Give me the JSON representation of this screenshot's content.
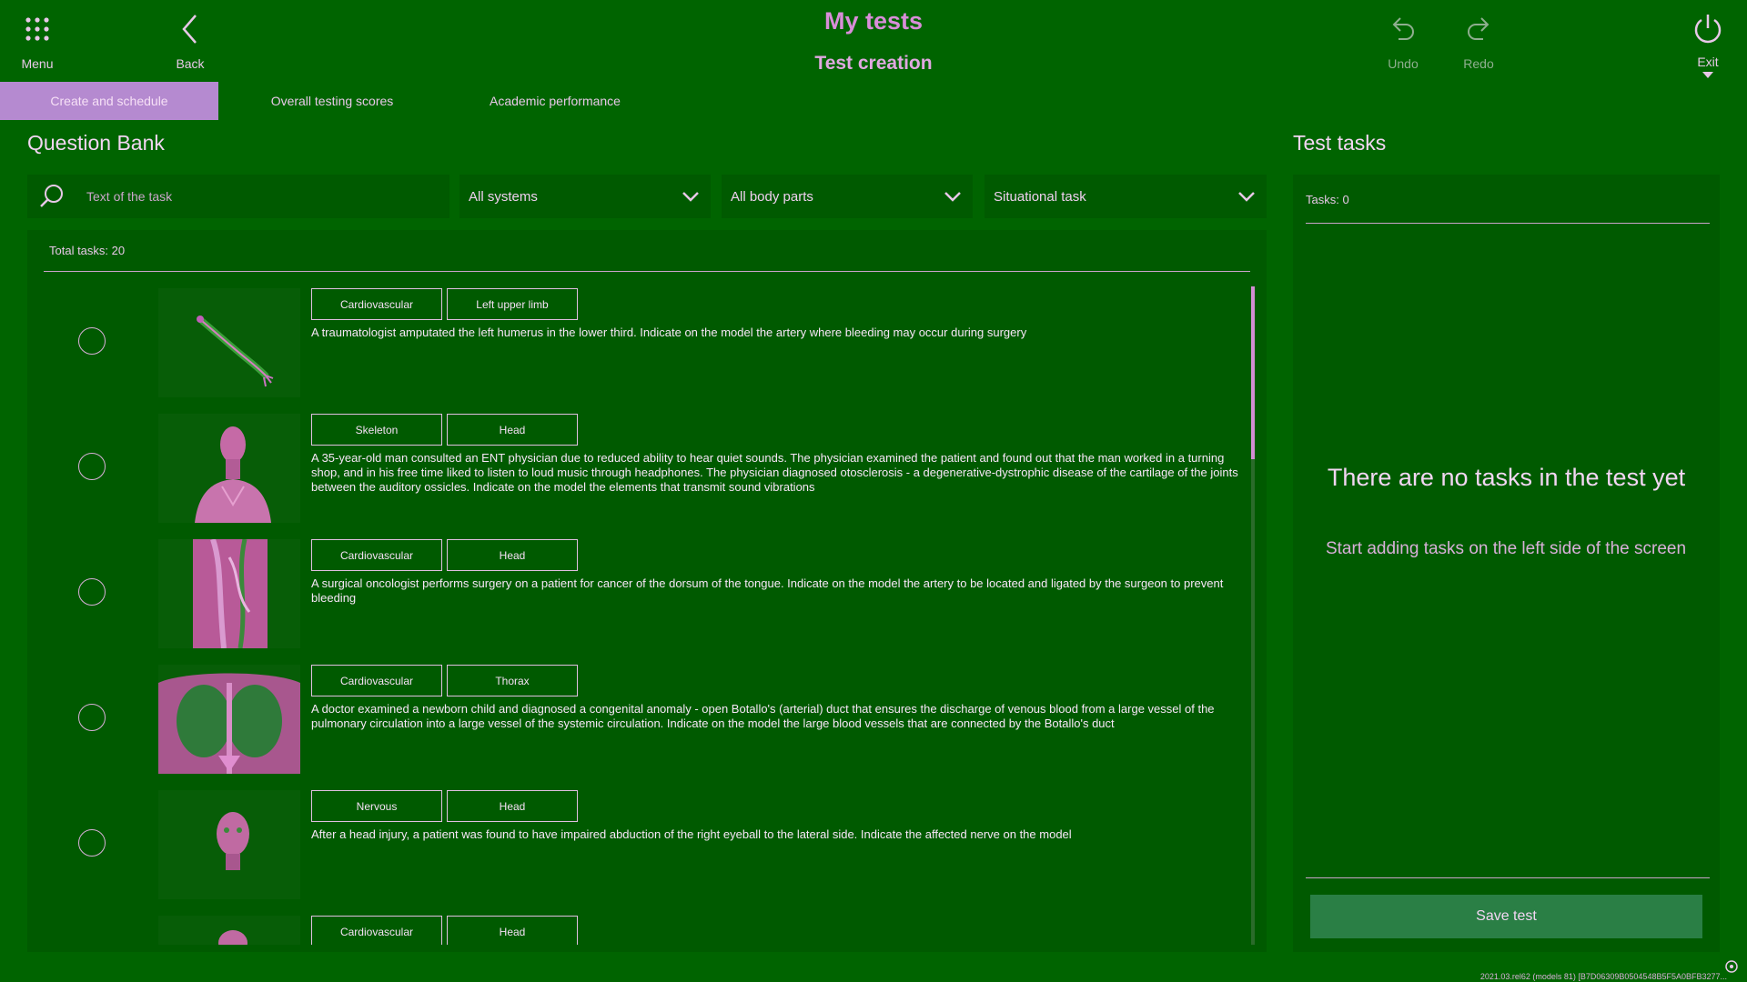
{
  "header": {
    "title": "My tests",
    "subtitle": "Test creation",
    "menu_label": "Menu",
    "back_label": "Back",
    "undo_label": "Undo",
    "redo_label": "Redo",
    "exit_label": "Exit"
  },
  "tabs": [
    {
      "label": "Create and schedule",
      "active": true
    },
    {
      "label": "Overall testing scores",
      "active": false
    },
    {
      "label": "Academic performance",
      "active": false
    }
  ],
  "question_bank": {
    "title": "Question Bank",
    "search_placeholder": "Text of the task",
    "filters": {
      "systems": "All systems",
      "body_parts": "All body parts",
      "task_type": "Situational task"
    },
    "total_label": "Total tasks: 20",
    "questions": [
      {
        "tags": [
          "Cardiovascular",
          "Left upper limb"
        ],
        "text": "A traumatologist amputated the left humerus in the lower third. Indicate on the model the artery where bleeding may occur during surgery",
        "thumb": "arm-model"
      },
      {
        "tags": [
          "Skeleton",
          "Head"
        ],
        "text": "A 35-year-old man consulted an ENT physician due to reduced ability to hear quiet sounds. The physician examined the patient and found out that the man worked in a turning shop, and in his free time liked to listen to loud music through headphones. The physician diagnosed otosclerosis - a degenerative-dystrophic disease of the cartilage of the joints between the auditory ossicles. Indicate on the model the elements that transmit sound vibrations",
        "thumb": "bust-model"
      },
      {
        "tags": [
          "Cardiovascular",
          "Head"
        ],
        "text": "A surgical oncologist performs surgery on a patient for cancer of the dorsum of the tongue. Indicate on the model the artery to be located and ligated by the surgeon to prevent bleeding",
        "thumb": "neck-model"
      },
      {
        "tags": [
          "Cardiovascular",
          "Thorax"
        ],
        "text": "A doctor examined a newborn child and diagnosed a congenital anomaly - open Botallo's (arterial) duct that ensures the discharge of venous blood from a large vessel of the pulmonary circulation into a large vessel of the systemic circulation. Indicate on the model the large blood vessels that are connected by the Botallo's duct",
        "thumb": "thorax-model"
      },
      {
        "tags": [
          "Nervous",
          "Head"
        ],
        "text": "After a head injury, a patient was found to have impaired abduction of the right eyeball to the lateral side. Indicate the affected nerve on the model",
        "thumb": "head-model"
      },
      {
        "tags": [
          "Cardiovascular",
          "Head"
        ],
        "text": "",
        "thumb": "head-model"
      }
    ]
  },
  "test_tasks": {
    "title": "Test tasks",
    "count_label": "Tasks: 0",
    "empty_title": "There are no tasks in the test yet",
    "empty_subtitle": "Start adding tasks on the left side of the screen",
    "save_label": "Save test"
  },
  "version_text": "2021.03.rel62 (models 81) [B7D06309B0504548B5F5A0BFB3277...",
  "colors": {
    "background": "#006400",
    "panel": "#005a00",
    "accent": "#b58ad0",
    "text": "#eeb3ee",
    "save_button": "#2a7f45"
  },
  "icons": {
    "menu": "grid-dots-icon",
    "back": "chevron-left-icon",
    "undo": "undo-icon",
    "redo": "redo-icon",
    "exit": "power-icon",
    "search": "search-icon",
    "dropdown": "chevron-down-icon"
  }
}
